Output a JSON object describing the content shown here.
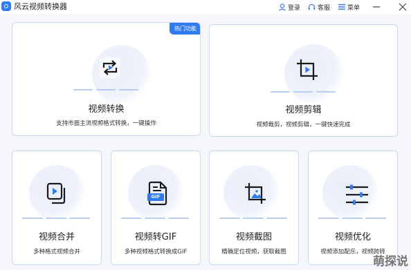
{
  "app": {
    "title": "风云视频转换器"
  },
  "toolbar": {
    "login": "登录",
    "service": "客服",
    "menu": "菜单"
  },
  "cards": {
    "convert": {
      "title": "视频转换",
      "desc": "支持市面主流视频格式转换，一键操作",
      "badge": "热门功能"
    },
    "edit": {
      "title": "视频剪辑",
      "desc": "视频裁剪，视频剪辑，一键快速完成"
    },
    "merge": {
      "title": "视频合并",
      "desc": "多种格式视频合并"
    },
    "gif": {
      "title": "视频转GIF",
      "desc": "多种视频格式转换成GIF",
      "icon_label": "GIF"
    },
    "crop": {
      "title": "视频截图",
      "desc": "精确定位视频，获取截图"
    },
    "optimize": {
      "title": "视频优化",
      "desc": "视频添加配乐，视频跨转"
    }
  },
  "watermark": "萌探说",
  "colors": {
    "accent": "#2f7bf5",
    "border": "#c7d8f5",
    "dash": "#b7cdf3"
  }
}
